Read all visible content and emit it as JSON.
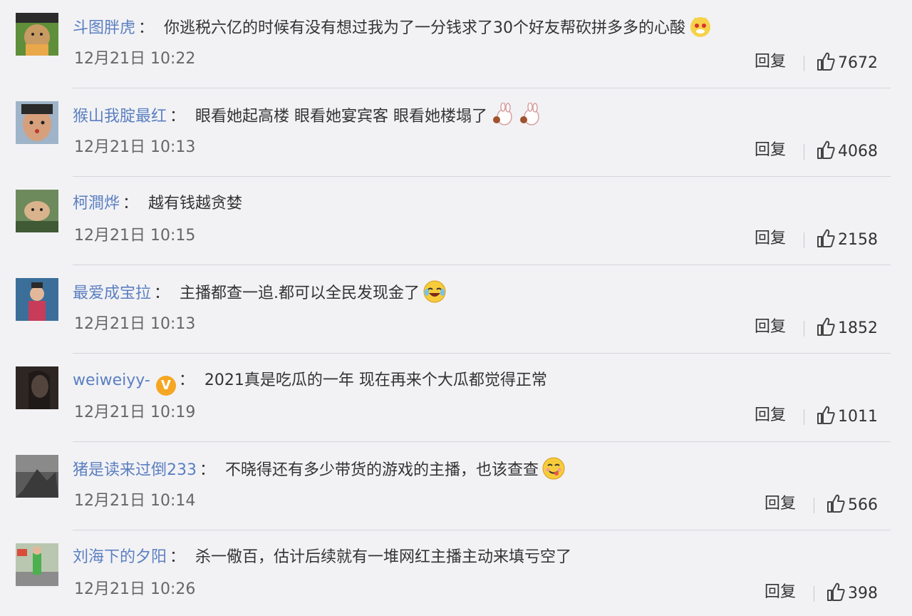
{
  "comments": [
    {
      "username": "斗图胖虎",
      "verified": false,
      "colon": "：",
      "text": "你逃税六亿的时候有没有想过我为了一分钱求了30个好友帮砍拼多多的心酸",
      "emoji": [
        "dog-emoji"
      ],
      "time": "12月21日 10:22",
      "reply": "回复",
      "likes": "7672"
    },
    {
      "username": "猴山我腚最红",
      "verified": false,
      "colon": "：",
      "text": "眼看她起高楼 眼看她宴宾客 眼看她楼塌了",
      "emoji": [
        "bunny-emoji",
        "bunny-emoji"
      ],
      "time": "12月21日 10:13",
      "reply": "回复",
      "likes": "4068"
    },
    {
      "username": "柯澗烨",
      "verified": false,
      "colon": "：",
      "text": "越有钱越贪婪",
      "emoji": [],
      "time": "12月21日 10:15",
      "reply": "回复",
      "likes": "2158"
    },
    {
      "username": "最爱成宝拉",
      "verified": false,
      "colon": "：",
      "text": "主播都查一追.都可以全民发现金了",
      "emoji": [
        "laugh-cry-emoji"
      ],
      "time": "12月21日 10:13",
      "reply": "回复",
      "likes": "1852"
    },
    {
      "username": "weiweiyy-",
      "verified": true,
      "verified_badge": "V",
      "colon": "：",
      "text": "2021真是吃瓜的一年 现在再来个大瓜都觉得正常",
      "emoji": [],
      "time": "12月21日 10:19",
      "reply": "回复",
      "likes": "1011"
    },
    {
      "username": "猪是读来过倒233",
      "verified": false,
      "colon": "：",
      "text": "不晓得还有多少带货的游戏的主播，也该查查",
      "emoji": [
        "yummy-emoji"
      ],
      "time": "12月21日 10:14",
      "reply": "回复",
      "likes": "566"
    },
    {
      "username": "刘海下的夕阳",
      "verified": false,
      "colon": "：",
      "text": "杀一儆百，估计后续就有一堆网红主播主动来填亏空了",
      "emoji": [],
      "time": "12月21日 10:26",
      "reply": "回复",
      "likes": "398"
    }
  ],
  "colors": {
    "username": "#5b7fc0",
    "background": "#f2f2f5",
    "text": "#333333",
    "badge": "#f5a623"
  }
}
